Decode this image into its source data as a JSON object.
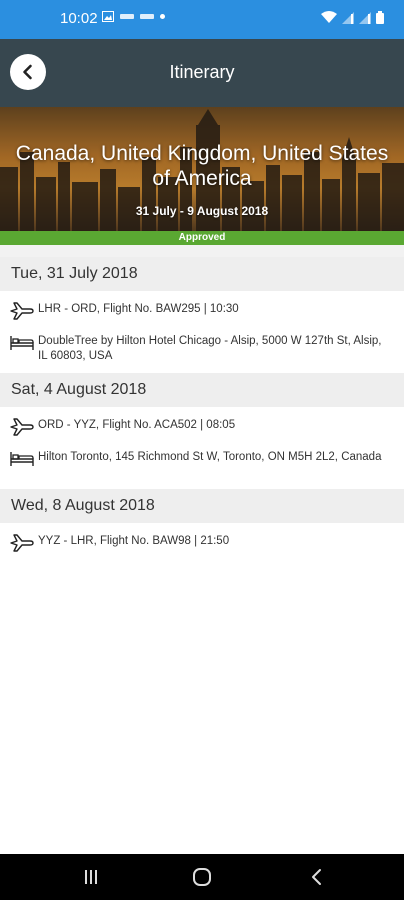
{
  "status_bar": {
    "time": "10:02"
  },
  "app_bar": {
    "title": "Itinerary"
  },
  "hero": {
    "title": "Canada, United Kingdom, United States of America",
    "dates": "31 July - 9 August 2018"
  },
  "trip_status": "Approved",
  "days": [
    {
      "header": "Tue, 31 July 2018",
      "items": [
        {
          "type": "flight",
          "icon": "plane-icon",
          "text": "LHR - ORD, Flight No. BAW295 | 10:30"
        },
        {
          "type": "hotel",
          "icon": "bed-icon",
          "text": "DoubleTree by Hilton Hotel Chicago - Alsip, 5000 W 127th St, Alsip, IL 60803, USA"
        }
      ]
    },
    {
      "header": "Sat, 4 August 2018",
      "items": [
        {
          "type": "flight",
          "icon": "plane-icon",
          "text": "ORD - YYZ, Flight No. ACA502 | 08:05"
        },
        {
          "type": "hotel",
          "icon": "bed-icon",
          "text": "Hilton Toronto, 145 Richmond St W, Toronto, ON M5H 2L2, Canada"
        }
      ]
    },
    {
      "header": "Wed, 8 August 2018",
      "items": [
        {
          "type": "flight",
          "icon": "plane-icon",
          "text": "YYZ - LHR, Flight No. BAW98 | 21:50"
        }
      ]
    }
  ],
  "colors": {
    "status_bar": "#2b8fe0",
    "app_bar": "#37474f",
    "approved": "#5aa832"
  }
}
